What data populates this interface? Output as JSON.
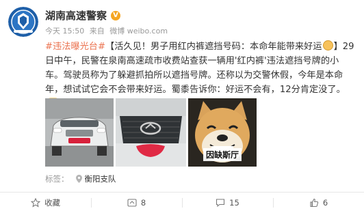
{
  "author": {
    "name": "湖南高速警察",
    "verified_badge": "V"
  },
  "meta": {
    "time": "今天 15:50",
    "via_prefix": "来自",
    "source": "微博 weibo.com"
  },
  "post": {
    "hashtag": "#违法曝光台#",
    "text_before_emoji": "【活久见！男子用红内裤遮挡号码：本命年能带来好运",
    "text_after_emoji": "】29日中午，民警在泉南高速疏市收费站查获一辆用'红内裤'违法遮挡号牌的小车。驾驶员称为了躲避抓拍所以遮挡号牌。还称以为交警休假，今年是本命年，想试试它会不会带来好运。蜀黍告诉你：好运不会有，12分肯定没了。"
  },
  "photos": {
    "caption_3": "因缺斯厅"
  },
  "tags": {
    "label": "标签：",
    "items": [
      "衡阳支队"
    ]
  },
  "actions": {
    "favorite": "收藏",
    "repost": "8",
    "comment": "15",
    "like": "6"
  },
  "colors": {
    "hashtag": "#eb7350",
    "badge": "#f5a623"
  }
}
